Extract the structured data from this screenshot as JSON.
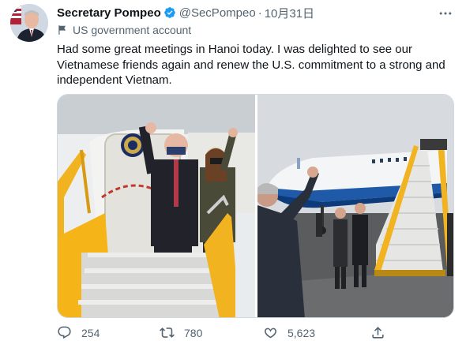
{
  "author": {
    "name": "Secretary Pompeo",
    "handle": "@SecPompeo",
    "separator": "·",
    "date": "10月31日",
    "label": "US government account"
  },
  "tweet": {
    "text": "Had some great meetings in Hanoi today. I was delighted to see our Vietnamese friends again and renew the U.S. commitment to a strong and independent Vietnam."
  },
  "actions": {
    "replies": "254",
    "retweets": "780",
    "likes": "5,623"
  },
  "icons": {
    "verified": "verified-badge-icon",
    "more": "more-options-icon",
    "flag": "flag-icon",
    "reply": "reply-icon",
    "retweet": "retweet-icon",
    "like": "like-heart-icon",
    "share": "share-icon"
  },
  "colors": {
    "verified_blue": "#1d9bf0",
    "secondary_text": "#536471",
    "stair_yellow": "#f2b320"
  }
}
